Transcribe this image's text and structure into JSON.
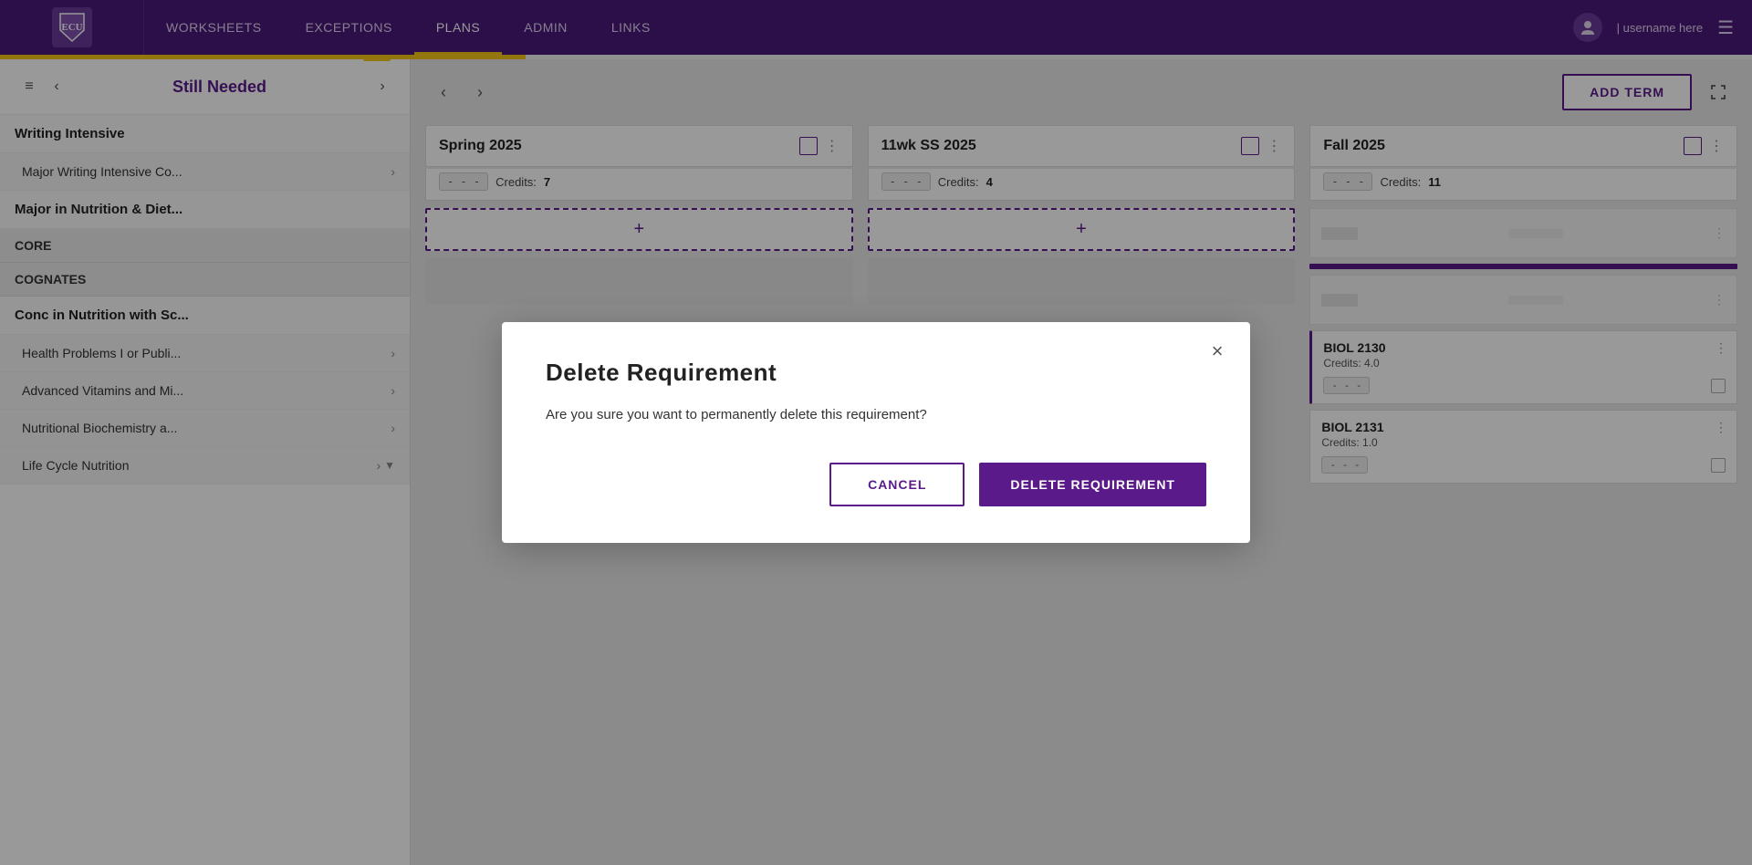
{
  "nav": {
    "logo_text": "ECU",
    "links": [
      {
        "label": "WORKSHEETS",
        "active": false
      },
      {
        "label": "EXCEPTIONS",
        "active": false
      },
      {
        "label": "PLANS",
        "active": true
      },
      {
        "label": "ADMIN",
        "active": false
      },
      {
        "label": "LINKS",
        "active": false
      }
    ],
    "user_name": "| username here",
    "hamburger_icon": "☰"
  },
  "sidebar": {
    "title": "Still Needed",
    "menu_icon": "≡",
    "prev_icon": "‹",
    "next_icon": "›",
    "sections": [
      {
        "type": "header",
        "label": "Writing Intensive"
      },
      {
        "type": "item",
        "label": "Major Writing Intensive Co...",
        "has_chevron": true
      },
      {
        "type": "header",
        "label": "Major in Nutrition & Diet..."
      },
      {
        "type": "label",
        "label": "CORE"
      },
      {
        "type": "label",
        "label": "COGNATES"
      },
      {
        "type": "header",
        "label": "Conc in Nutrition with Sc..."
      },
      {
        "type": "item",
        "label": "Health Problems I or Publi...",
        "has_chevron": true
      },
      {
        "type": "item",
        "label": "Advanced Vitamins and Mi...",
        "has_chevron": true
      },
      {
        "type": "item",
        "label": "Nutritional Biochemistry a...",
        "has_chevron": true
      },
      {
        "type": "item",
        "label": "Life Cycle Nutrition",
        "has_chevron": true,
        "has_down": true
      }
    ]
  },
  "toolbar": {
    "add_term_label": "ADD TERM",
    "prev_arrow": "‹",
    "next_arrow": "›",
    "fullscreen_icon": "⛶"
  },
  "terms": [
    {
      "id": "spring2025",
      "title": "Spring  2025",
      "badge": "- - -",
      "credits_label": "Credits:",
      "credits_value": "7",
      "courses": [],
      "has_placeholder": true
    },
    {
      "id": "ss2025",
      "title": "11wk SS 2025",
      "badge": "- - -",
      "credits_label": "Credits:",
      "credits_value": "4",
      "courses": [],
      "has_placeholder": true
    },
    {
      "id": "fall2025",
      "title": "Fall  2025",
      "badge": "- - -",
      "credits_label": "Credits:",
      "credits_value": "11",
      "courses": [
        {
          "name": "BIOL 2130",
          "credits": "Credits: 4.0",
          "badge": "- - -",
          "highlighted": true
        },
        {
          "name": "BIOL 2131",
          "credits": "Credits: 1.0",
          "badge": "- - -",
          "highlighted": false
        }
      ]
    }
  ],
  "modal": {
    "title": "Delete  Requirement",
    "body": "Are you sure you want to permanently delete this requirement?",
    "cancel_label": "CANCEL",
    "delete_label": "DELETE REQUIREMENT",
    "close_icon": "×"
  }
}
